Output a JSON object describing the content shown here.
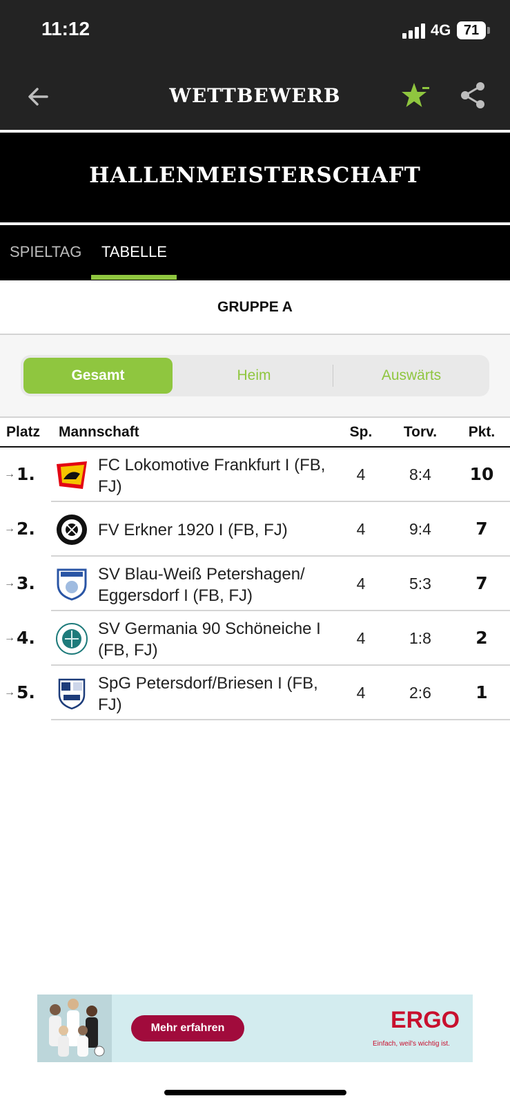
{
  "status_bar": {
    "time": "11:12",
    "network": "4G",
    "battery": "71"
  },
  "top_bar": {
    "title": "WETTBEWERB",
    "back_icon": "arrow-left-icon",
    "favorite_icon": "star-icon",
    "share_icon": "share-icon"
  },
  "competition": {
    "title": "HALLENMEISTERSCHAFT"
  },
  "tabs": [
    {
      "label": "SPIELTAG"
    },
    {
      "label": "TABELLE",
      "active": true
    }
  ],
  "group": {
    "title": "GRUPPE A"
  },
  "segments": [
    {
      "label": "Gesamt",
      "active": true
    },
    {
      "label": "Heim"
    },
    {
      "label": "Auswärts"
    }
  ],
  "table": {
    "headers": {
      "platz": "Platz",
      "mannschaft": "Mannschaft",
      "sp": "Sp.",
      "torv": "Torv.",
      "pkt": "Pkt."
    },
    "rows": [
      {
        "rank": "1.",
        "team": "FC Lokomotive Frankfurt I (FB, FJ)",
        "sp": "4",
        "torv": "8:4",
        "pkt": "10"
      },
      {
        "rank": "2.",
        "team": "FV Erkner 1920 I (FB, FJ)",
        "sp": "4",
        "torv": "9:4",
        "pkt": "7"
      },
      {
        "rank": "3.",
        "team": "SV Blau-Weiß Petershagen/ Eggersdorf I (FB, FJ)",
        "sp": "4",
        "torv": "5:3",
        "pkt": "7"
      },
      {
        "rank": "4.",
        "team": "SV Germania 90 Schöneiche I (FB, FJ)",
        "sp": "4",
        "torv": "1:8",
        "pkt": "2"
      },
      {
        "rank": "5.",
        "team": "SpG Petersdorf/Briesen I (FB, FJ)",
        "sp": "4",
        "torv": "2:6",
        "pkt": "1"
      }
    ]
  },
  "ad": {
    "button": "Mehr erfahren",
    "brand": "ERGO",
    "slogan": "Einfach, weil's wichtig ist."
  },
  "colors": {
    "accent": "#8fc63f",
    "dark": "#232323",
    "ad_red": "#c8102e",
    "ad_button": "#a10b3c"
  }
}
